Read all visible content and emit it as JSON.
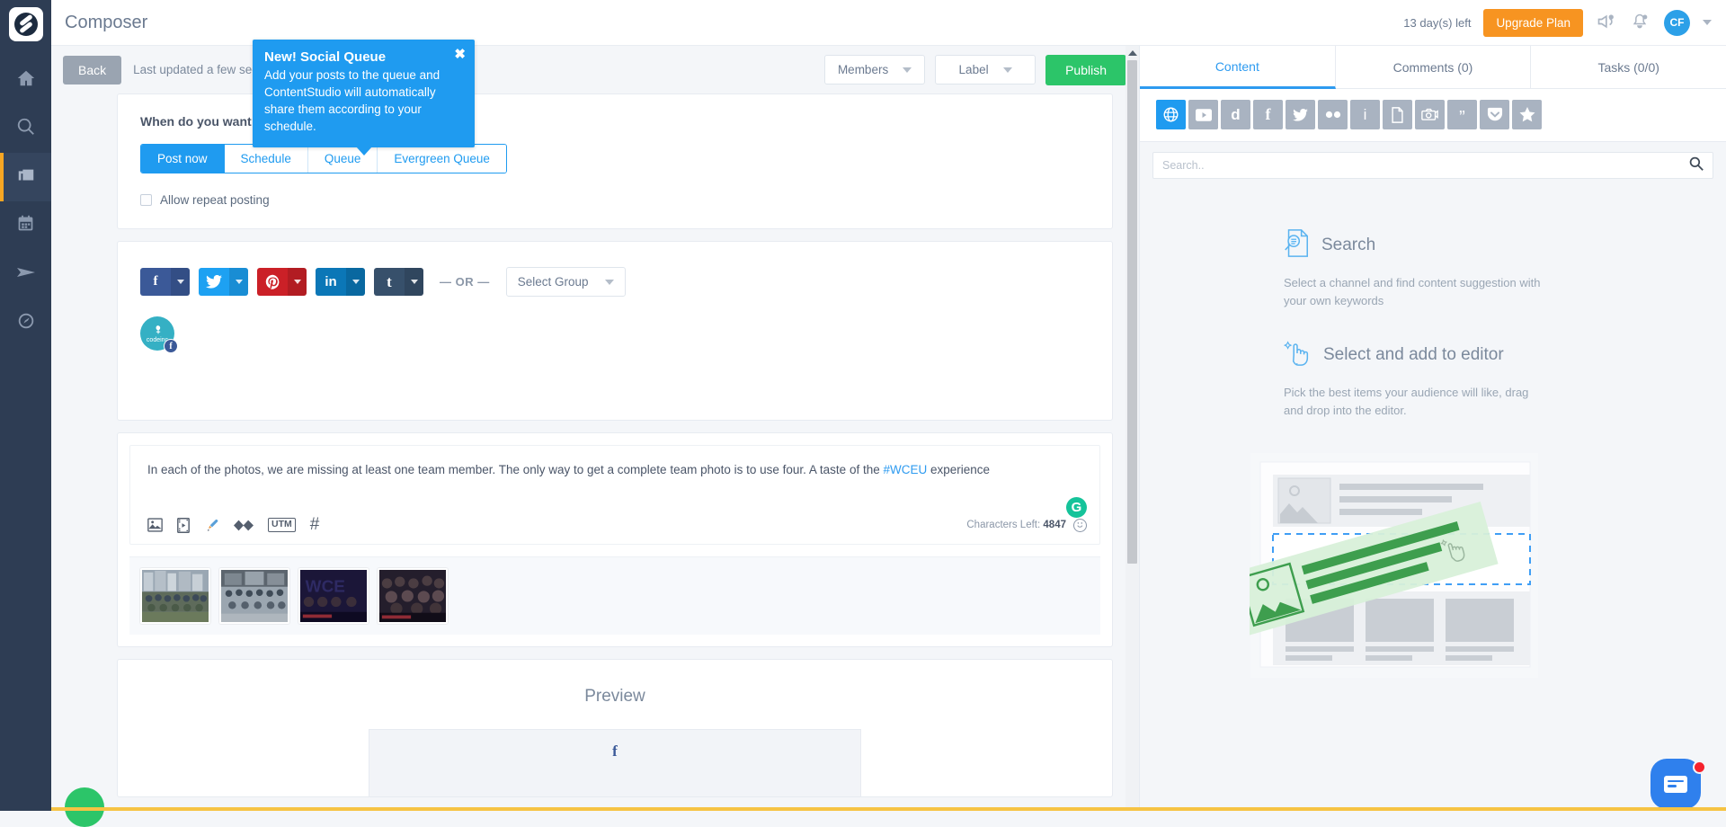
{
  "app": {
    "title": "Composer",
    "logo_name": "contentstudio-logo"
  },
  "topbar": {
    "days_left": "13 day(s) left",
    "upgrade_label": "Upgrade Plan",
    "avatar_initials": "CF",
    "icons": [
      "announcement-icon",
      "notification-bell-icon"
    ]
  },
  "sidebar": {
    "items": [
      {
        "name": "home",
        "label": "Home"
      },
      {
        "name": "discovery",
        "label": "Discovery"
      },
      {
        "name": "composer",
        "label": "Composer",
        "active": true
      },
      {
        "name": "planner",
        "label": "Planner"
      },
      {
        "name": "publish",
        "label": "Publish"
      },
      {
        "name": "analytics",
        "label": "Analytics"
      }
    ]
  },
  "composer_toolbar": {
    "back_label": "Back",
    "last_updated": "Last updated a few seconds ago",
    "members_label": "Members",
    "label_label": "Label",
    "publish_label": "Publish"
  },
  "tooltip": {
    "title": "New! Social Queue",
    "body": "Add your posts to the queue and ContentStudio will automatically share them according to your schedule.",
    "close": "✖"
  },
  "when_card": {
    "heading": "When do you want to publish?",
    "tabs": [
      {
        "label": "Post now",
        "active": true
      },
      {
        "label": "Schedule",
        "active": false
      },
      {
        "label": "Queue",
        "active": false
      },
      {
        "label": "Evergreen Queue",
        "active": false
      }
    ],
    "repeat_label": "Allow repeat posting",
    "repeat_checked": false
  },
  "accounts_card": {
    "networks": [
      {
        "name": "facebook",
        "glyph": "f",
        "color": "#3b5998"
      },
      {
        "name": "twitter",
        "glyph": "🐦",
        "color": "#1da1f2"
      },
      {
        "name": "pinterest",
        "glyph": "Ⓟ",
        "color": "#cb2027"
      },
      {
        "name": "linkedin",
        "glyph": "in",
        "color": "#0b77b7"
      },
      {
        "name": "tumblr",
        "glyph": "t",
        "color": "#37506b"
      }
    ],
    "or_separator": "— OR —",
    "select_group_label": "Select Group",
    "selected_account": {
      "name": "codeinc",
      "network_badge": "f",
      "color": "#35b0c4"
    }
  },
  "editor_card": {
    "text_before_hashtag": "In each of the photos, we are missing at least one team member. The only way to get a complete team photo is to use four. A taste of the ",
    "hashtag": "#WCEU",
    "text_after_hashtag": " experience",
    "grammarly_glyph": "G",
    "tools": [
      {
        "name": "add-image-icon",
        "label": "Image"
      },
      {
        "name": "add-video-icon",
        "label": "Video"
      },
      {
        "name": "brush-icon",
        "label": "Design"
      },
      {
        "name": "link-shortener-icon",
        "label": "Shorten link"
      },
      {
        "name": "utm-icon",
        "label": "UTM"
      },
      {
        "name": "hashtag-icon",
        "label": "Hashtag"
      }
    ],
    "utm_label": "UTM",
    "hashtag_glyph": "#",
    "chars_left_label": "Characters Left:",
    "chars_left_value": "4847",
    "thumbnails": [
      {
        "name": "team-photo-outdoor-group",
        "alt": "Team group photo outdoors"
      },
      {
        "name": "team-photo-entrance-group",
        "alt": "Team group photo at entrance"
      },
      {
        "name": "wceu-stage-photo",
        "alt": "WCEU stage photo"
      },
      {
        "name": "wceu-crowd-photo",
        "alt": "WCEU crowd photo"
      }
    ]
  },
  "preview_card": {
    "title": "Preview",
    "network_glyph": "f",
    "network_name": "facebook"
  },
  "right_panel": {
    "tabs": [
      {
        "label": "Content",
        "active": true
      },
      {
        "label": "Comments (0)",
        "active": false
      },
      {
        "label": "Tasks (0/0)",
        "active": false
      }
    ],
    "sources": [
      {
        "name": "web-globe-icon",
        "glyph": "ἱ0",
        "active": true
      },
      {
        "name": "youtube-icon",
        "glyph": "▶",
        "active": false
      },
      {
        "name": "daily-motion-icon",
        "glyph": "d",
        "active": false
      },
      {
        "name": "facebook-icon",
        "glyph": "f",
        "active": false
      },
      {
        "name": "twitter-icon",
        "glyph": "🐦",
        "active": false
      },
      {
        "name": "flickr-icon",
        "glyph": "••",
        "active": false
      },
      {
        "name": "instagram-icon",
        "glyph": "i",
        "active": false
      },
      {
        "name": "article-icon",
        "glyph": "Ὄ4",
        "active": false
      },
      {
        "name": "giphy-icon",
        "glyph": "὏7",
        "active": false
      },
      {
        "name": "quotes-icon",
        "glyph": "”",
        "active": false
      },
      {
        "name": "pocket-icon",
        "glyph": "⌄",
        "active": false
      },
      {
        "name": "favorites-icon",
        "glyph": "★",
        "active": false
      }
    ],
    "search_placeholder": "Search..",
    "search_value": "",
    "blocks": [
      {
        "icon": "search-document-icon",
        "title": "Search",
        "description": "Select a channel and find content suggestion with your own keywords"
      },
      {
        "icon": "select-hand-icon",
        "title": "Select and add to editor",
        "description": "Pick the best items your audience will like, drag and drop into the editor."
      }
    ]
  },
  "floating": {
    "help_bubble_name": "help-bubble",
    "chat_widget_name": "chat-widget",
    "chat_unread": true
  },
  "colors": {
    "accent_blue": "#1f9bf0",
    "publish_green": "#2cc569",
    "upgrade_orange": "#f79421",
    "rail_dark": "#2e3d54",
    "page_bg": "#f4f6f9",
    "bottom_strip": "#f6c343"
  }
}
